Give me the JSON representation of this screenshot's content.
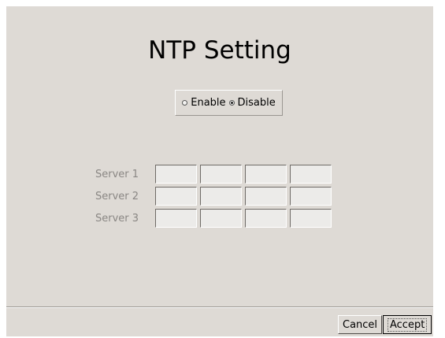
{
  "dialog": {
    "title": "NTP Setting"
  },
  "mode": {
    "options": [
      {
        "label": "Enable",
        "checked": false
      },
      {
        "label": "Disable",
        "checked": true
      }
    ]
  },
  "servers": [
    {
      "label": "Server 1",
      "octets": [
        "",
        "",
        "",
        ""
      ]
    },
    {
      "label": "Server 2",
      "octets": [
        "",
        "",
        "",
        ""
      ]
    },
    {
      "label": "Server 3",
      "octets": [
        "",
        "",
        "",
        ""
      ]
    }
  ],
  "buttons": {
    "cancel": "Cancel",
    "accept": "Accept"
  }
}
